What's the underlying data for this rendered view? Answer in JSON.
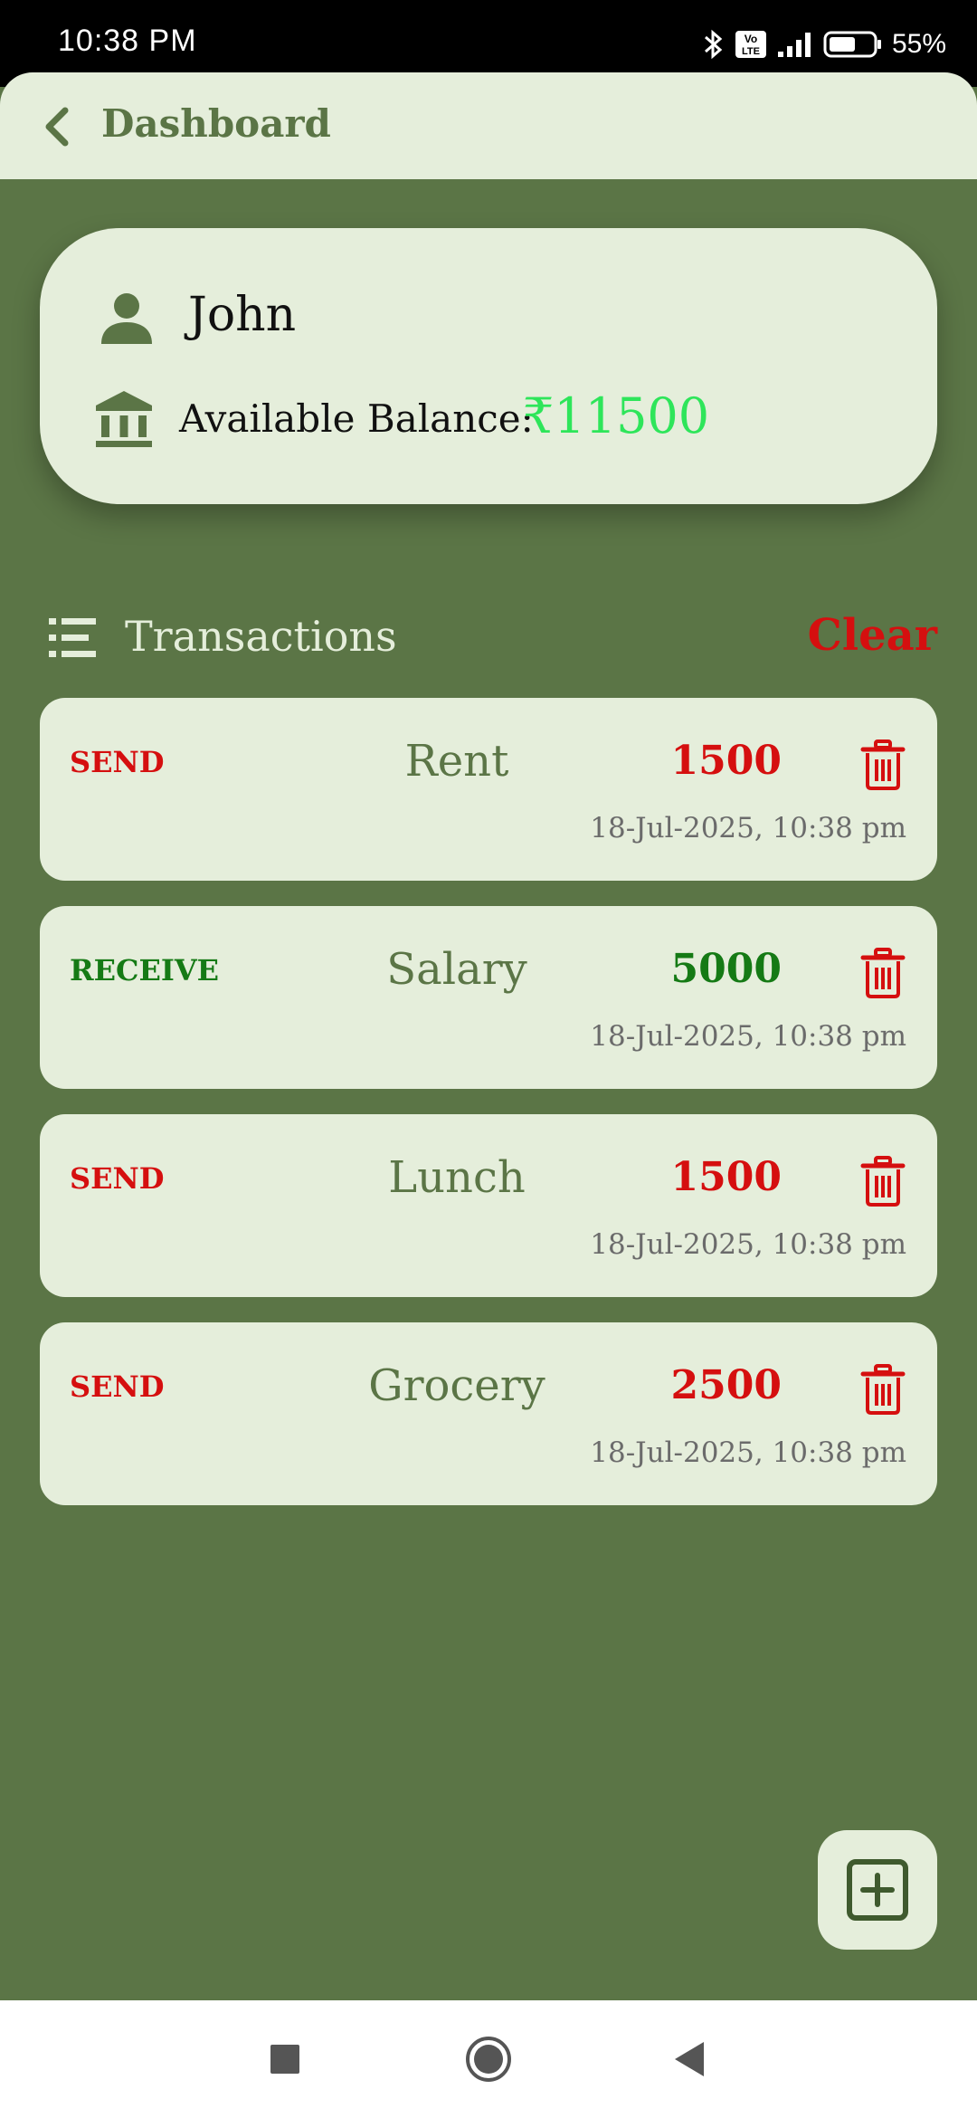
{
  "status_bar": {
    "time": "10:38 PM",
    "battery_percent": "55%",
    "volte_badge_top": "Vo",
    "volte_badge_bottom": "LTE",
    "icons": [
      "bluetooth-icon",
      "volte-icon",
      "signal-icon",
      "battery-icon"
    ]
  },
  "app_bar": {
    "title": "Dashboard",
    "back_icon": "chevron-left-icon"
  },
  "account": {
    "name": "John",
    "balance_label": "Available Balance:",
    "balance_value": "₹11500",
    "balance_color": "#2ee55a",
    "icons": [
      "person-icon",
      "bank-icon"
    ]
  },
  "transactions": {
    "title": "Transactions",
    "clear_label": "Clear",
    "items": [
      {
        "type": "SEND",
        "description": "Rent",
        "amount": "1500",
        "date": "18-Jul-2025, 10:38 pm"
      },
      {
        "type": "RECEIVE",
        "description": "Salary",
        "amount": "5000",
        "date": "18-Jul-2025, 10:38 pm"
      },
      {
        "type": "SEND",
        "description": "Lunch",
        "amount": "1500",
        "date": "18-Jul-2025, 10:38 pm"
      },
      {
        "type": "SEND",
        "description": "Grocery",
        "amount": "2500",
        "date": "18-Jul-2025, 10:38 pm"
      }
    ]
  },
  "colors": {
    "background": "#5b7546",
    "surface": "#e5eedb",
    "send": "#d50f0f",
    "receive": "#157a15"
  },
  "fab": {
    "icon": "add-box-icon"
  },
  "nav_bar": {
    "icons": [
      "recents-square-icon",
      "home-circle-icon",
      "back-triangle-icon"
    ]
  }
}
